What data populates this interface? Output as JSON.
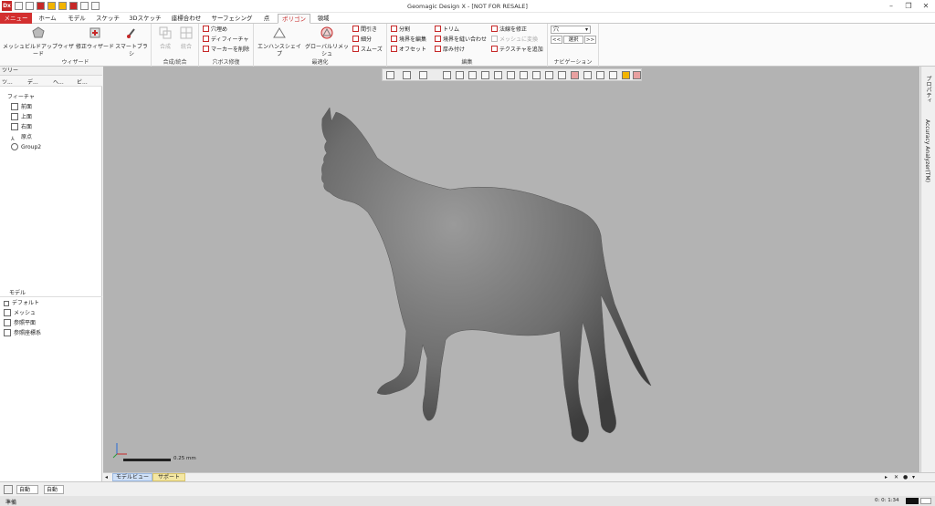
{
  "window": {
    "title": "Geomagic Design X - [NOT FOR RESALE]",
    "logo": "Dx"
  },
  "menu": {
    "tabs": [
      "メニュー",
      "ホーム",
      "モデル",
      "スケッチ",
      "3Dスケッチ",
      "座標合わせ",
      "サーフェシング",
      "点",
      "ポリゴン",
      "領域"
    ],
    "active": "ポリゴン"
  },
  "ribbon": {
    "wizard": {
      "label": "ウィザード",
      "buttons": [
        "メッシュビルドアップウィザード",
        "修正ウィザード",
        "スマートブラシ"
      ]
    },
    "merge": {
      "label": "合成/統合",
      "buttons": [
        "合成",
        "統合"
      ]
    },
    "hole": {
      "label": "穴ボス修復",
      "items": [
        "穴埋め",
        "ディフィーチャ",
        "マーカーを削除"
      ]
    },
    "optimize": {
      "label": "最適化",
      "buttons": [
        "エンハンスシェイプ",
        "グローバルリメッシュ"
      ],
      "items": [
        "間引き",
        "細分",
        "スムーズ"
      ]
    },
    "edit": {
      "label": "編集",
      "items_a": [
        "分割",
        "境界を編集",
        "オフセット"
      ],
      "items_b": [
        "トリム",
        "境界を縫い合わせ",
        "厚み付け"
      ],
      "items_c": [
        "法線を修正",
        "メッシュに変換",
        "テクスチャを追加"
      ]
    },
    "nav": {
      "label": "ナビゲーション",
      "select_value": "穴",
      "prev": "<<",
      "select": "選択",
      "next": ">>"
    }
  },
  "tree": {
    "header": "ツリー",
    "tabs": [
      "ツ...",
      "デ...",
      "ヘ...",
      "ビ..."
    ],
    "feature_header": "フィーチャ",
    "features": [
      "前面",
      "上面",
      "右面",
      "原点",
      "Group2"
    ],
    "model_header": "モデル",
    "model_items": [
      "デフォルト",
      "メッシュ",
      "参照平面",
      "参照座標系"
    ]
  },
  "right_strip": {
    "items": [
      "プロパティ",
      "Accuracy Analyzer(TM)"
    ]
  },
  "viewport": {
    "scale_label": "0.25 mm"
  },
  "bottom_tabs": {
    "items": [
      "モデルビュー",
      "サポート"
    ]
  },
  "status": {
    "auto": "自動",
    "auto2": "自動",
    "ready": "準備",
    "time": "0: 0: 1:34"
  },
  "colors": {
    "accent": "#d32f2f",
    "viewport": "#b3b3b3"
  }
}
